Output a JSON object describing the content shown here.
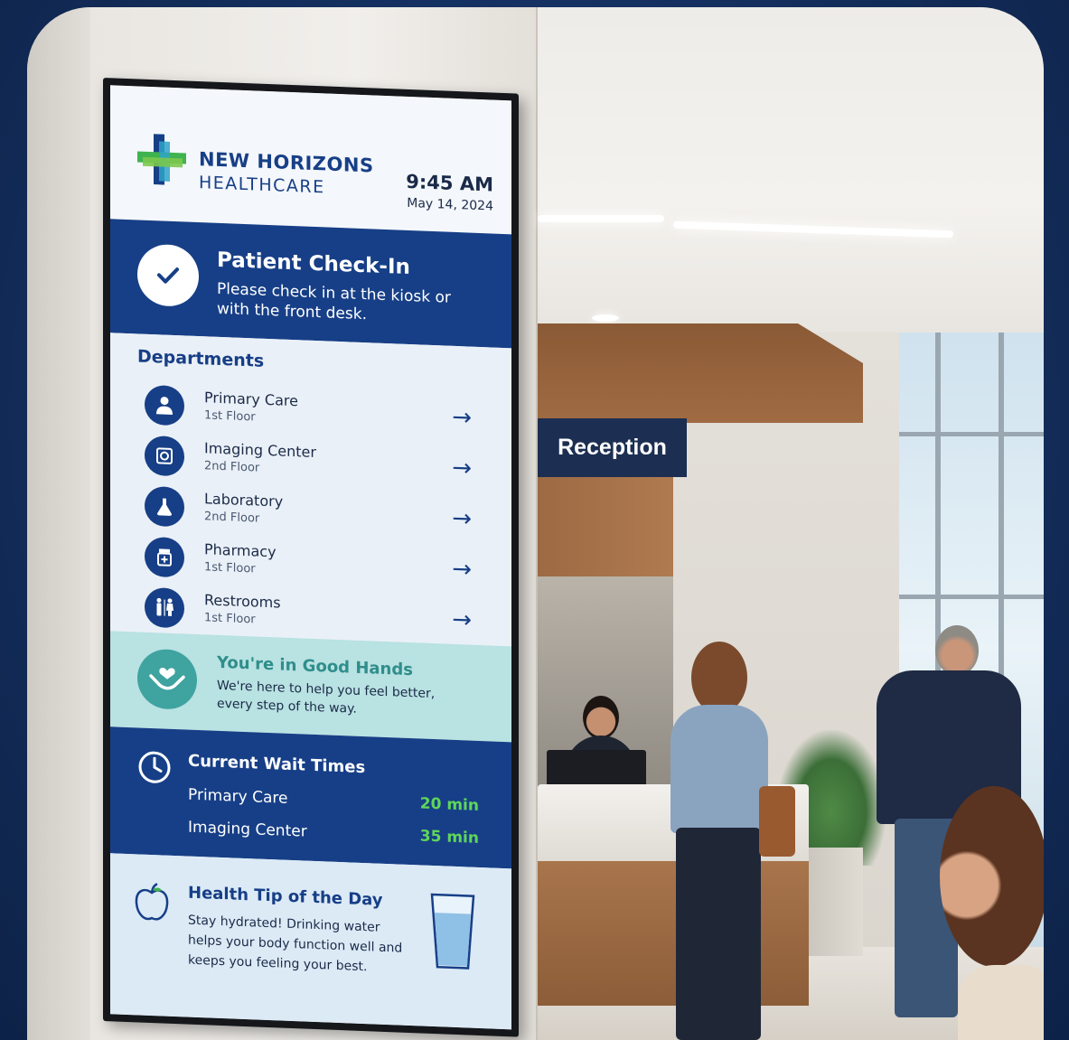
{
  "scene": {
    "reception_sign": "Reception"
  },
  "display": {
    "brand": {
      "line1": "NEW HORIZONS",
      "line2": "HEALTHCARE"
    },
    "clock": {
      "time": "9:45 AM",
      "date": "May 14, 2024"
    },
    "checkin": {
      "title": "Patient Check-In",
      "subtitle": "Please check in at the kiosk or with the front desk.",
      "icon": "checkmark-icon"
    },
    "departments": {
      "title": "Departments",
      "items": [
        {
          "name": "Primary Care",
          "floor": "1st Floor",
          "icon": "doctor-icon"
        },
        {
          "name": "Imaging Center",
          "floor": "2nd Floor",
          "icon": "scanner-icon"
        },
        {
          "name": "Laboratory",
          "floor": "2nd Floor",
          "icon": "flask-icon"
        },
        {
          "name": "Pharmacy",
          "floor": "1st Floor",
          "icon": "pill-bottle-icon"
        },
        {
          "name": "Restrooms",
          "floor": "1st Floor",
          "icon": "restroom-icon"
        }
      ],
      "arrow": "→"
    },
    "good_hands": {
      "title": "You're in Good Hands",
      "subtitle": "We're here to help you feel better, every step of the way.",
      "icon": "caring-hands-icon"
    },
    "wait_times": {
      "title": "Current Wait Times",
      "rows": [
        {
          "label": "Primary Care",
          "value": "20 min"
        },
        {
          "label": "Imaging Center",
          "value": "35 min"
        }
      ],
      "icon": "clock-icon"
    },
    "health_tip": {
      "title": "Health Tip of the Day",
      "body": "Stay hydrated! Drinking water helps your body function well and keeps you feeling your best.",
      "icon": "apple-icon",
      "illustration": "water-glass-icon"
    }
  },
  "colors": {
    "navy": "#173f87",
    "teal": "#3fa3a0",
    "wait_green": "#5fd65a",
    "background": "#142f5e"
  }
}
